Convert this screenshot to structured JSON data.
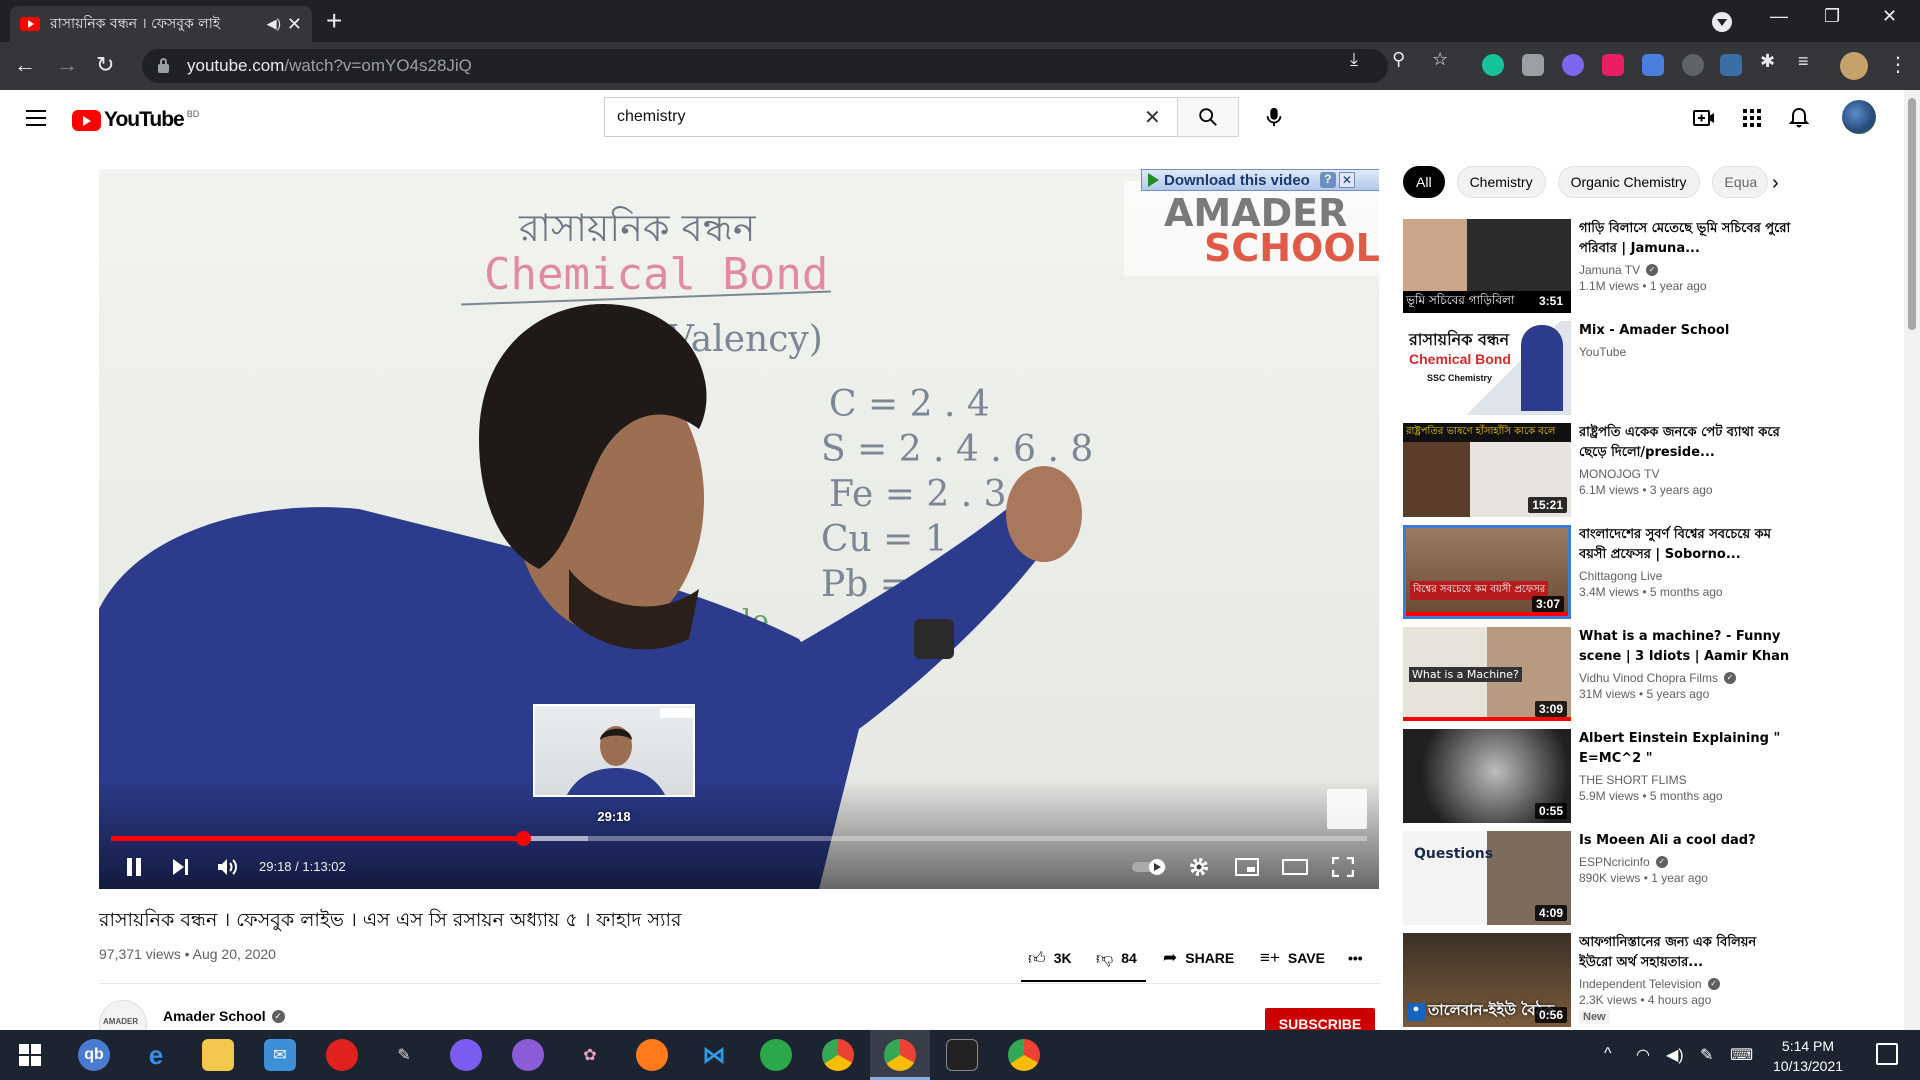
{
  "browser": {
    "tab_title": "রাসায়নিক বন্ধন । ফেসবুক লাই",
    "new_tab": "+",
    "url_host": "youtube.com",
    "url_path": "/watch?v=omYO4s28JiQ"
  },
  "yt": {
    "logo": "YouTube",
    "country": "BD",
    "search_value": "chemistry"
  },
  "player": {
    "download_label": "Download this video",
    "logo_line1": "AMADER",
    "logo_line2": "SCHOOL",
    "board_title_bn": "রাসায়নিক বন্ধন",
    "board_title_en": "Chemical Bond",
    "board_valency": "(Valency)",
    "board_eq1": "C = 2 . 4",
    "board_eq2": "S = 2 . 4 . 6 . 8",
    "board_eq3": "Fe = 2 . 3",
    "board_eq4": "Cu = 1",
    "board_eq5": "Pb =",
    "board_variable": "Variable",
    "preview_time": "29:18",
    "time_current": "29:18",
    "time_total": "1:13:02",
    "time_separator": " / ",
    "played_fraction": 0.328,
    "loaded_fraction": 0.38
  },
  "video": {
    "title": "রাসায়নিক বন্ধন । ফেসবুক লাইভ । এস এস সি রসায়ন অধ্যায় ৫ । ফাহাদ স্যার",
    "meta": "97,371 views • Aug 20, 2020",
    "likes": "3K",
    "dislikes": "84",
    "share": "SHARE",
    "save": "SAVE",
    "channel": "Amader School",
    "subscribe": "SUBSCRIBE"
  },
  "chips": [
    "All",
    "Chemistry",
    "Organic Chemistry",
    "Equa"
  ],
  "recommendations": [
    {
      "title": "গাড়ি বিলাসে মেতেছে ভূমি সচিবের পুরো পরিবার | Jamuna...",
      "channel": "Jamuna TV",
      "verified": true,
      "meta": "1.1M views • 1 year ago",
      "duration": "3:51",
      "thumb_caption": "ভূমি সচিবের গাড়িবিলা",
      "badge": ""
    },
    {
      "title": "Mix - Amader School",
      "channel": "YouTube",
      "verified": false,
      "meta": "",
      "duration": "",
      "thumb_caption": "রাসায়নিক বন্ধন",
      "thumb_caption2": "Chemical Bond",
      "thumb_caption3": "SSC Chemistry",
      "badge": ""
    },
    {
      "title": "রাষ্ট্রপতি একেক জনকে পেট ব্যাথা করে ছেড়ে দিলো/preside...",
      "channel": "MONOJOG TV",
      "verified": false,
      "meta": "6.1M views • 3 years ago",
      "duration": "15:21",
      "thumb_caption": "রাষ্ট্রপতির ভাষণে হাঁসাহাঁসি কাকে বলে",
      "badge": ""
    },
    {
      "title": "বাংলাদেশের সুবর্ণ বিশ্বের সবচেয়ে কম বয়সী প্রফেসর | Soborno...",
      "channel": "Chittagong Live",
      "verified": false,
      "meta": "3.4M views • 5 months ago",
      "duration": "3:07",
      "thumb_caption": "বিশ্বের সবচেয়ে কম বয়সী প্রফেসর",
      "badge": ""
    },
    {
      "title": "What is a machine? - Funny scene | 3 Idiots | Aamir Khan ...",
      "channel": "Vidhu Vinod Chopra Films",
      "verified": true,
      "meta": "31M views • 5 years ago",
      "duration": "3:09",
      "thumb_caption": "What is a Machine?",
      "badge": ""
    },
    {
      "title": "Albert Einstein Explaining \" E=MC^2 \"",
      "channel": "THE SHORT FLIMS",
      "verified": false,
      "meta": "5.9M views • 5 months ago",
      "duration": "0:55",
      "thumb_caption": "",
      "badge": ""
    },
    {
      "title": "Is Moeen Ali a cool dad?",
      "channel": "ESPNcricinfo",
      "verified": true,
      "meta": "890K views • 1 year ago",
      "duration": "4:09",
      "thumb_caption": "Questions",
      "badge": ""
    },
    {
      "title": "আফগানিস্তানের জন্য এক বিলিয়ন ইউরো অর্থ সহায়তার...",
      "channel": "Independent Television",
      "verified": true,
      "meta": "2.3K views • 4 hours ago",
      "duration": "0:56",
      "thumb_caption": "তালেবান-ইইউ বৈঠক",
      "badge": "New"
    }
  ],
  "taskbar": {
    "time": "5:14 PM",
    "date": "10/13/2021"
  },
  "colors": {
    "yt_red": "#ff0000",
    "subscribe_red": "#cc0000",
    "chrome_dark": "#202124",
    "taskbar": "#1c2431"
  }
}
